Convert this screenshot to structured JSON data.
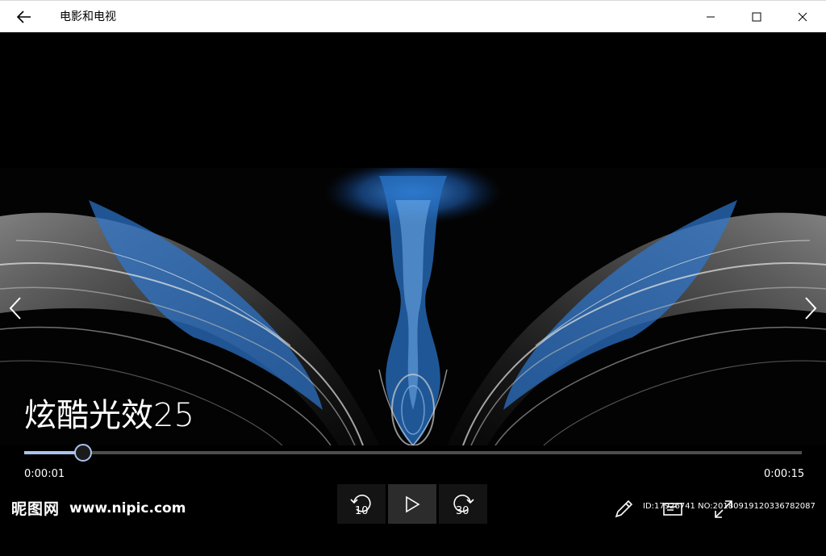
{
  "app": {
    "title": "电影和电视"
  },
  "video": {
    "title": "炫酷光效25"
  },
  "player": {
    "current_time": "0:00:01",
    "total_time": "0:00:15",
    "progress_fraction": 0.076,
    "skip_back_seconds": "10",
    "skip_forward_seconds": "30"
  },
  "watermark": {
    "logo": "昵图网",
    "url": "www.nipic.com",
    "id": "ID:17926741 NO:20180919120336782087"
  },
  "colors": {
    "accent": "#a9c3ee",
    "titlebar": "#ffffff",
    "background": "#000000"
  }
}
